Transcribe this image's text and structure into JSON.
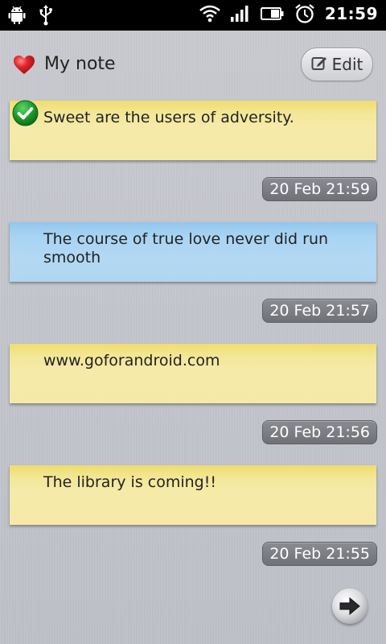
{
  "status_bar": {
    "time": "21:59",
    "left_icons": [
      "android-debug-icon",
      "usb-icon"
    ],
    "right_icons": [
      "wifi-icon",
      "signal-icon",
      "battery-icon",
      "alarm-icon"
    ]
  },
  "header": {
    "title": "My note",
    "edit_label": "Edit",
    "heart_color": "#e0252d"
  },
  "notes": [
    {
      "text": "Sweet are the users of adversity.",
      "timestamp": "20 Feb 21:59",
      "color": "yellow",
      "checked": true
    },
    {
      "text": "The course of true love never did run smooth",
      "timestamp": "20 Feb 21:57",
      "color": "blue",
      "checked": false
    },
    {
      "text": "www.goforandroid.com",
      "timestamp": "20 Feb 21:56",
      "color": "yellow",
      "checked": false
    },
    {
      "text": "The library is coming!!",
      "timestamp": "20 Feb 21:55",
      "color": "yellow",
      "checked": false
    }
  ],
  "colors": {
    "note_yellow": "#f5e9a8",
    "note_blue": "#b0d6f0",
    "check_green": "#1a9b2a",
    "timestamp_bg": "#7a7c82"
  }
}
